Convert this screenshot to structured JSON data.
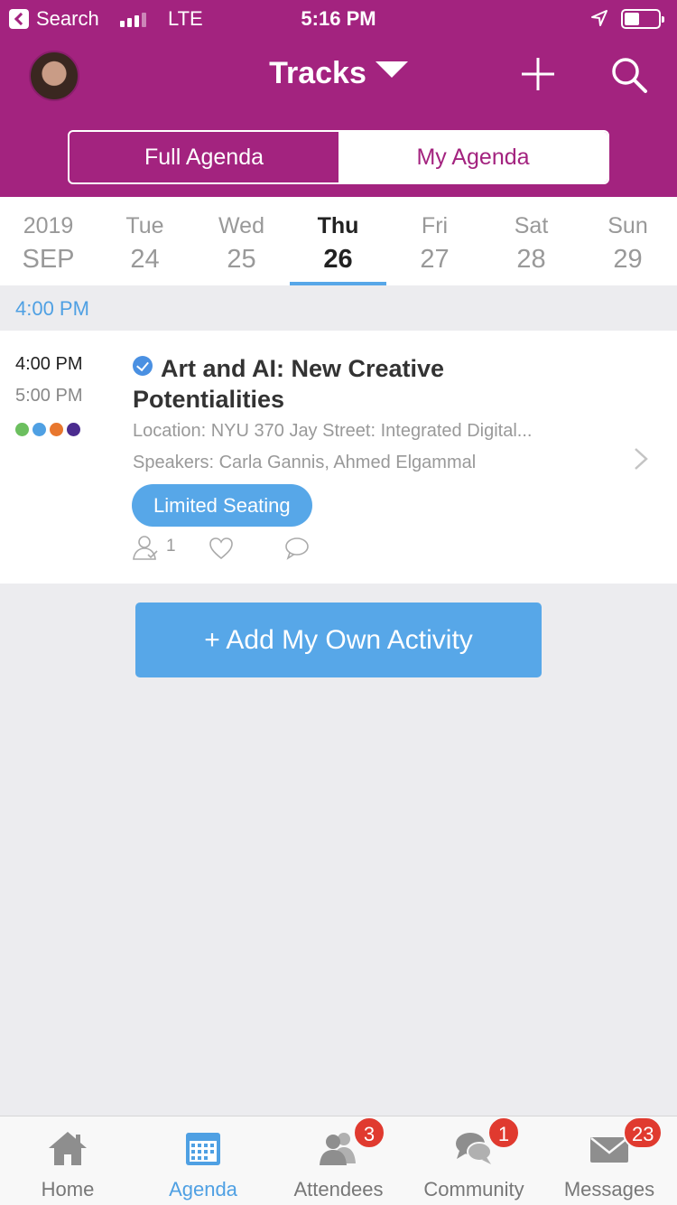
{
  "status_bar": {
    "back_label": "Search",
    "carrier": "LTE",
    "time": "5:16 PM"
  },
  "header": {
    "title": "Tracks",
    "segments": {
      "full": "Full Agenda",
      "mine": "My Agenda",
      "selected": "My Agenda"
    }
  },
  "dates": {
    "year_month": {
      "top": "2019",
      "bottom": "SEP"
    },
    "days": [
      {
        "top": "Tue",
        "num": "24"
      },
      {
        "top": "Wed",
        "num": "25"
      },
      {
        "top": "Thu",
        "num": "26",
        "selected": true
      },
      {
        "top": "Fri",
        "num": "27"
      },
      {
        "top": "Sat",
        "num": "28"
      },
      {
        "top": "Sun",
        "num": "29"
      }
    ]
  },
  "time_header": "4:00 PM",
  "event": {
    "start": "4:00 PM",
    "end": "5:00 PM",
    "track_colors": [
      "#6cbf5f",
      "#4fa0e3",
      "#e8772e",
      "#4b2c8f"
    ],
    "title": "Art and AI: New Creative Potentialities",
    "location": "Location: NYU 370 Jay Street: Integrated Digital...",
    "speakers": "Speakers: Carla Gannis, Ahmed Elgammal",
    "badge": "Limited Seating",
    "attendee_count": "1"
  },
  "add_button": "+ Add My Own Activity",
  "tabs": [
    {
      "label": "Home",
      "icon": "home-icon"
    },
    {
      "label": "Agenda",
      "icon": "calendar-icon",
      "active": true
    },
    {
      "label": "Attendees",
      "icon": "people-icon",
      "badge": "3"
    },
    {
      "label": "Community",
      "icon": "chat-icon",
      "badge": "1"
    },
    {
      "label": "Messages",
      "icon": "envelope-icon",
      "badge": "23"
    }
  ],
  "colors": {
    "brand": "#a3237f",
    "accent": "#57a7e8",
    "badge": "#e03a2f"
  }
}
